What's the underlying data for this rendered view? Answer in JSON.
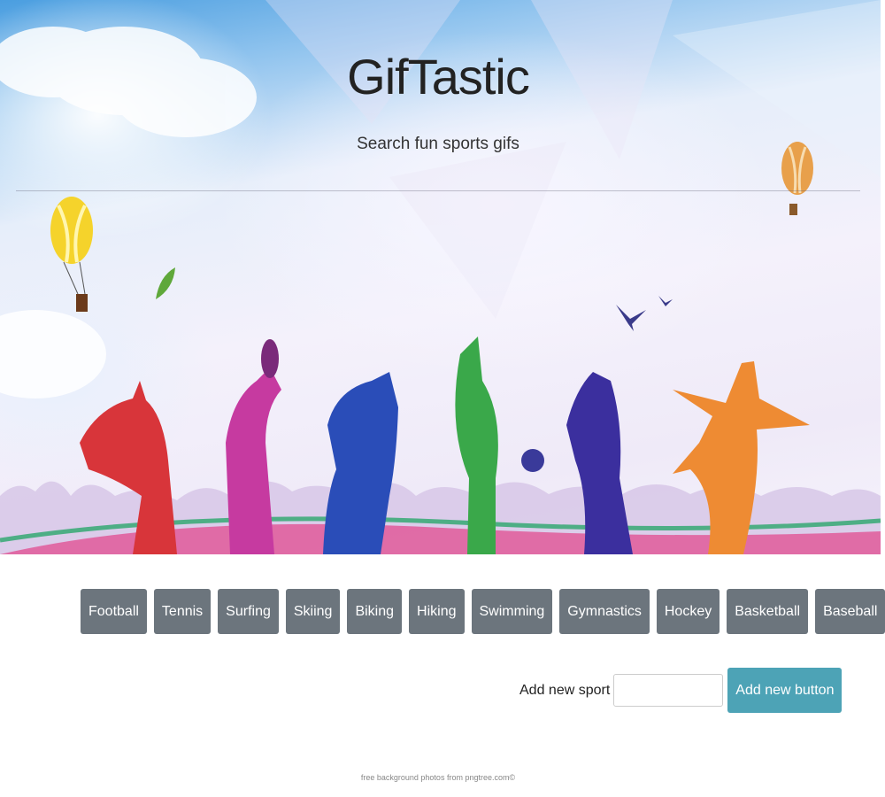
{
  "header": {
    "title": "GifTastic",
    "subtitle": "Search fun sports gifs"
  },
  "sports": [
    "Football",
    "Tennis",
    "Surfing",
    "Skiing",
    "Biking",
    "Hiking",
    "Swimming",
    "Gymnastics",
    "Hockey",
    "Basketball",
    "Baseball"
  ],
  "add_form": {
    "label": "Add new sport",
    "input_value": "",
    "button_label": "Add new button"
  },
  "footer": {
    "credit": "free background photos from pngtree.com©"
  },
  "colors": {
    "sport_button": "#6c757d",
    "add_button": "#4da3b6"
  }
}
